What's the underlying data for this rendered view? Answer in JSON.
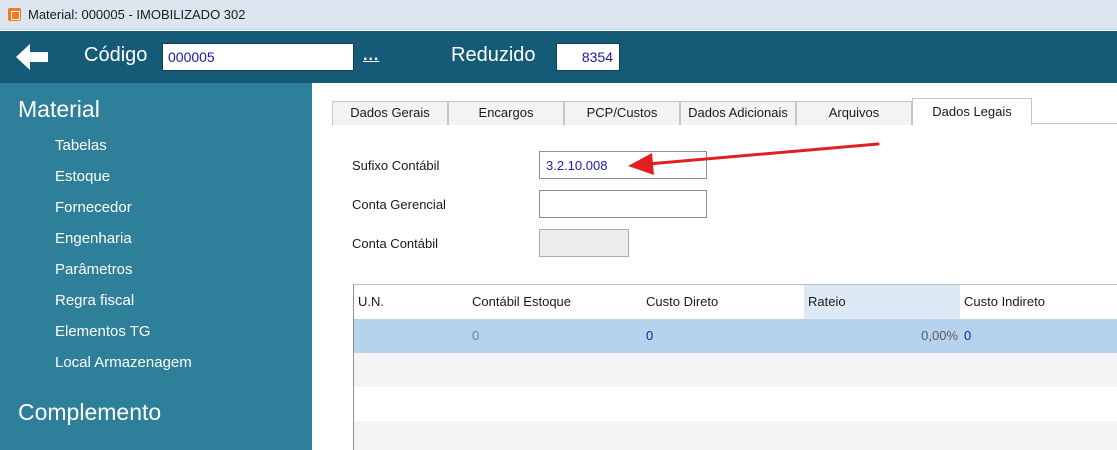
{
  "window": {
    "title": "Material: 000005 - IMOBILIZADO 302"
  },
  "toolbar": {
    "codigo_label": "Código",
    "codigo_value": "000005",
    "ellipsis_label": "...",
    "reduzido_label": "Reduzido",
    "reduzido_value": "8354"
  },
  "sidebar": {
    "section1_title": "Material",
    "items": [
      "Tabelas",
      "Estoque",
      "Fornecedor",
      "Engenharia",
      "Parâmetros",
      "Regra fiscal",
      "Elementos TG",
      "Local Armazenagem"
    ],
    "section2_title": "Complemento"
  },
  "tabs": [
    {
      "label": "Dados Gerais"
    },
    {
      "label": "Encargos"
    },
    {
      "label": "PCP/Custos"
    },
    {
      "label": "Dados Adicionais"
    },
    {
      "label": "Arquivos"
    },
    {
      "label": "Dados Legais"
    }
  ],
  "active_tab": "Dados Legais",
  "form": {
    "sufixo_label": "Sufixo Contábil",
    "sufixo_value": "3.2.10.008",
    "conta_gerencial_label": "Conta Gerencial",
    "conta_gerencial_value": "",
    "conta_contabil_label": "Conta Contábil",
    "conta_contabil_value": ""
  },
  "grid": {
    "columns": [
      "U.N.",
      "Contábil Estoque",
      "Custo Direto",
      "Rateio",
      "Custo Indireto"
    ],
    "rows": [
      [
        "",
        "0",
        "0",
        "0,00%",
        "0"
      ]
    ]
  },
  "colors": {
    "header_bg": "#155a77",
    "sidebar_bg": "#2e7f99",
    "selected_row": "#b6d3ed",
    "annotation_arrow": "#e02020",
    "field_text": "#1a1aa8"
  }
}
